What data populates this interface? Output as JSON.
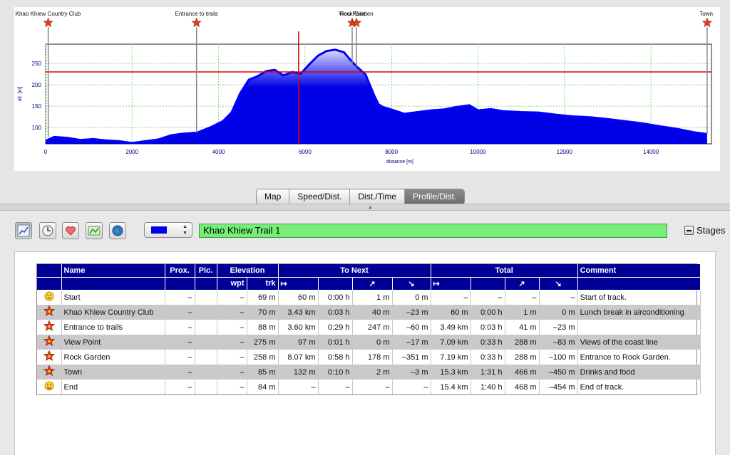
{
  "chart": {
    "y_label": "alt. [m]",
    "x_label": "distance [m]",
    "y_ticks": [
      "100",
      "150",
      "200",
      "250"
    ],
    "x_ticks": [
      "0",
      "2000",
      "4000",
      "6000",
      "8000",
      "10000",
      "12000",
      "14000"
    ],
    "colors": {
      "fill": "#0000e6",
      "line": "#0000ff",
      "grid": "#7fd97f",
      "cursor": "#e00000",
      "star": "#e8401a"
    },
    "waypoint_labels": [
      {
        "label": "Khao Khiew Country Club",
        "distance": 60
      },
      {
        "label": "Entrance to trails",
        "distance": 3490
      },
      {
        "label": "View Point",
        "distance": 7090
      },
      {
        "label": "Rock Garden",
        "distance": 7190
      },
      {
        "label": "Town",
        "distance": 15300
      }
    ]
  },
  "chart_data": {
    "type": "area",
    "x_unit": "m",
    "y_unit": "m",
    "xlim": [
      0,
      15400
    ],
    "ylim": [
      62,
      295
    ],
    "x": [
      0,
      200,
      500,
      800,
      1100,
      1400,
      1700,
      2000,
      2300,
      2600,
      2900,
      3200,
      3500,
      3800,
      4100,
      4300,
      4500,
      4700,
      4900,
      5100,
      5300,
      5500,
      5700,
      5900,
      6100,
      6300,
      6500,
      6700,
      6900,
      7050,
      7200,
      7400,
      7600,
      7700,
      7800,
      8000,
      8300,
      8600,
      8900,
      9200,
      9500,
      9800,
      10000,
      10300,
      10600,
      11000,
      11400,
      11800,
      12200,
      12600,
      13000,
      13400,
      13800,
      14200,
      14600,
      15000,
      15300
    ],
    "y": [
      69,
      78,
      76,
      71,
      73,
      70,
      68,
      64,
      68,
      72,
      82,
      86,
      88,
      100,
      115,
      135,
      180,
      212,
      220,
      232,
      235,
      222,
      230,
      226,
      248,
      268,
      279,
      282,
      276,
      258,
      242,
      224,
      175,
      154,
      148,
      142,
      132,
      136,
      140,
      142,
      148,
      152,
      140,
      143,
      138,
      136,
      135,
      130,
      126,
      124,
      120,
      115,
      110,
      103,
      97,
      89,
      85
    ],
    "cursor_distance": 5850,
    "cursor_altitude": 230
  },
  "tabs": [
    {
      "label": "Map",
      "active": false
    },
    {
      "label": "Speed/Dist.",
      "active": false
    },
    {
      "label": "Dist./Time",
      "active": false
    },
    {
      "label": "Profile/Dist.",
      "active": true
    }
  ],
  "toolbar": {
    "buttons": [
      "profile-icon",
      "clock-icon",
      "heart-icon",
      "route-icon",
      "globe-icon"
    ],
    "track_color": "#0000e6",
    "track_name": "Khao Khiew Trail 1",
    "stages_label": "Stages"
  },
  "table": {
    "header1": {
      "name": "Name",
      "prox": "Prox.",
      "pic": "Pic.",
      "elevation": "Elevation",
      "to_next": "To Next",
      "total": "Total",
      "comment": "Comment"
    },
    "header2": {
      "wpt": "wpt",
      "trk": "trk",
      "dist_icon": "↦",
      "up_icon": "↗",
      "down_icon": "↘"
    },
    "rows": [
      {
        "icon": "start",
        "name": "Start",
        "prox": "–",
        "wpt": "–",
        "trk": "69 m",
        "next_dist": "60 m",
        "next_time": "0:00 h",
        "next_up": "1 m",
        "next_down": "0 m",
        "tot_dist": "–",
        "tot_time": "–",
        "tot_up": "–",
        "tot_down": "–",
        "comment": "Start of track."
      },
      {
        "icon": "star",
        "name": "Khao Khiew Country Club",
        "prox": "–",
        "wpt": "–",
        "trk": "70 m",
        "next_dist": "3.43 km",
        "next_time": "0:03 h",
        "next_up": "40 m",
        "next_down": "–23 m",
        "tot_dist": "60 m",
        "tot_time": "0:00 h",
        "tot_up": "1 m",
        "tot_down": "0 m",
        "comment": "Lunch break in airconditioning"
      },
      {
        "icon": "star",
        "name": "Entrance to trails",
        "prox": "–",
        "wpt": "–",
        "trk": "88 m",
        "next_dist": "3.60 km",
        "next_time": "0:29 h",
        "next_up": "247 m",
        "next_down": "–60 m",
        "tot_dist": "3.49 km",
        "tot_time": "0:03 h",
        "tot_up": "41 m",
        "tot_down": "–23 m",
        "comment": ""
      },
      {
        "icon": "star",
        "name": "View Point",
        "prox": "–",
        "wpt": "–",
        "trk": "275 m",
        "next_dist": "97 m",
        "next_time": "0:01 h",
        "next_up": "0 m",
        "next_down": "–17 m",
        "tot_dist": "7.09 km",
        "tot_time": "0:33 h",
        "tot_up": "288 m",
        "tot_down": "–83 m",
        "comment": "Views of the coast line"
      },
      {
        "icon": "star",
        "name": "Rock Garden",
        "prox": "–",
        "wpt": "–",
        "trk": "258 m",
        "next_dist": "8.07 km",
        "next_time": "0:58 h",
        "next_up": "178 m",
        "next_down": "–351 m",
        "tot_dist": "7.19 km",
        "tot_time": "0:33 h",
        "tot_up": "288 m",
        "tot_down": "–100 m",
        "comment": "Entrance to Rock Garden."
      },
      {
        "icon": "star",
        "name": "Town",
        "prox": "–",
        "wpt": "–",
        "trk": "85 m",
        "next_dist": "132 m",
        "next_time": "0:10 h",
        "next_up": "2 m",
        "next_down": "–3 m",
        "tot_dist": "15.3 km",
        "tot_time": "1:31 h",
        "tot_up": "466 m",
        "tot_down": "–450 m",
        "comment": "Drinks and food"
      },
      {
        "icon": "end",
        "name": "End",
        "prox": "–",
        "wpt": "–",
        "trk": "84 m",
        "next_dist": "–",
        "next_time": "–",
        "next_up": "–",
        "next_down": "–",
        "tot_dist": "15.4 km",
        "tot_time": "1:40 h",
        "tot_up": "468 m",
        "tot_down": "–454 m",
        "comment": "End of track."
      }
    ]
  }
}
